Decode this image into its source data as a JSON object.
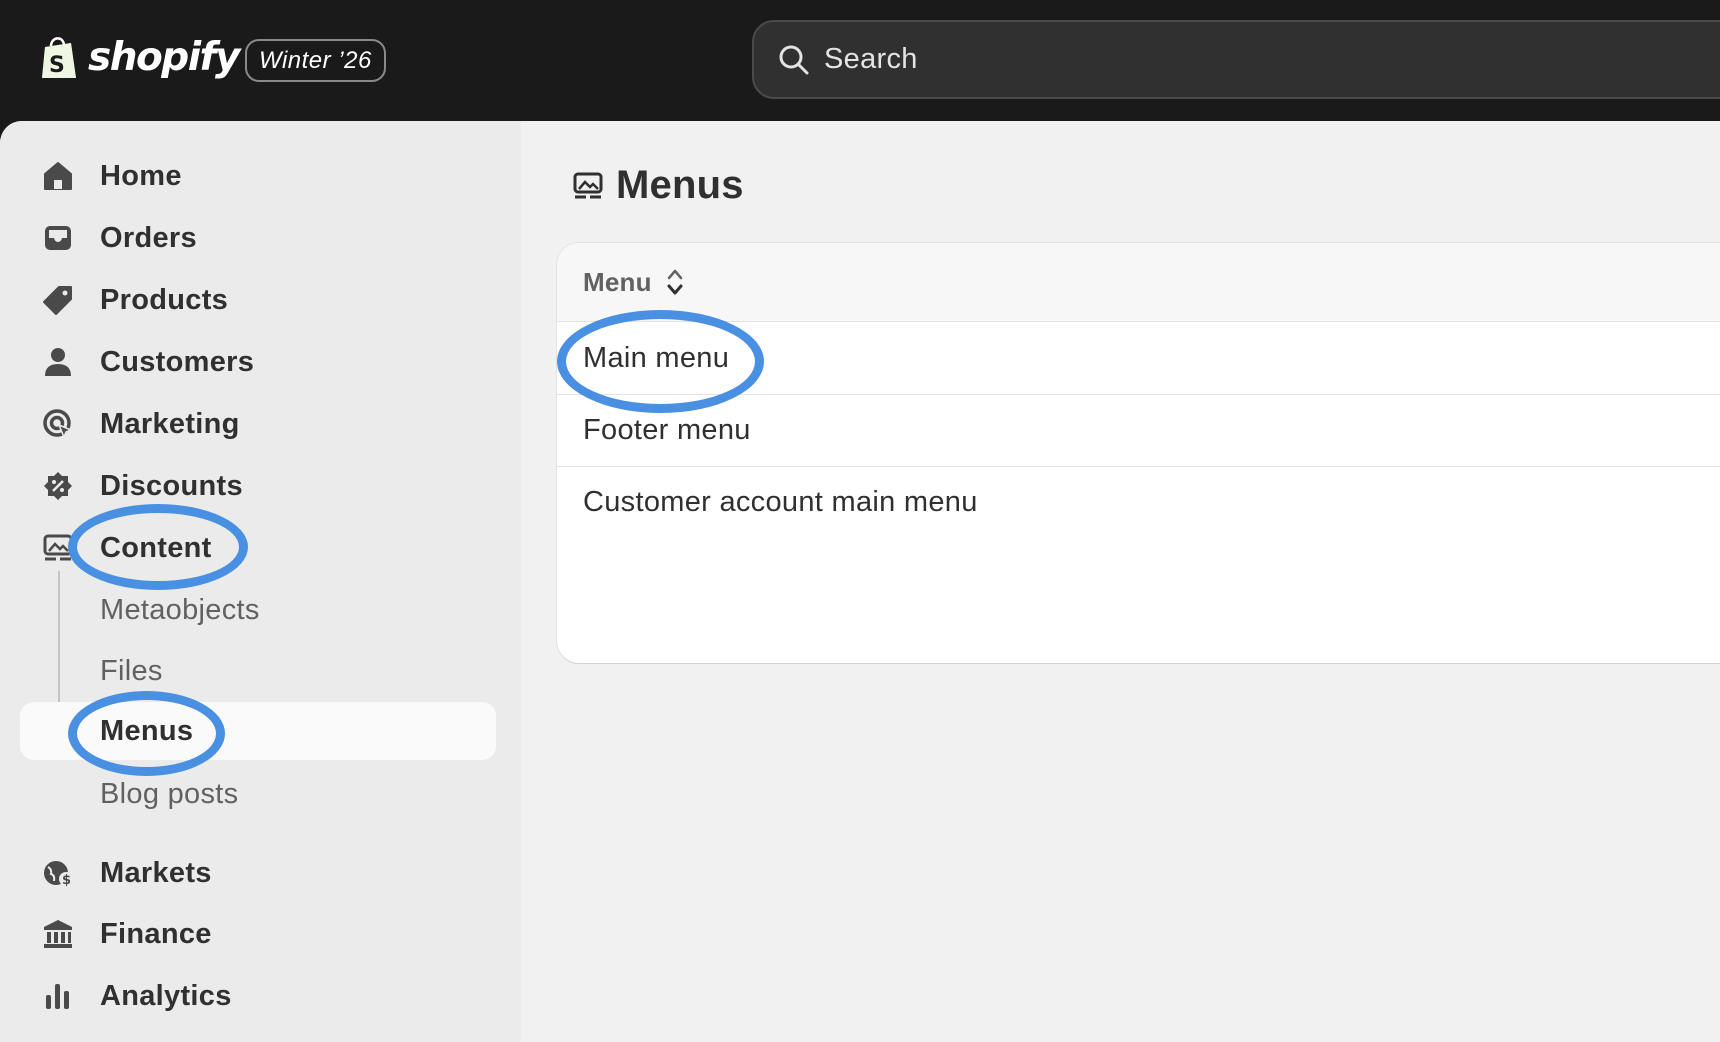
{
  "topbar": {
    "brand": "shopify",
    "edition": "Winter ’26",
    "search_placeholder": "Search"
  },
  "sidebar": {
    "items": [
      {
        "label": "Home",
        "icon": "home-icon"
      },
      {
        "label": "Orders",
        "icon": "inbox-icon"
      },
      {
        "label": "Products",
        "icon": "tag-icon"
      },
      {
        "label": "Customers",
        "icon": "person-icon"
      },
      {
        "label": "Marketing",
        "icon": "target-icon"
      },
      {
        "label": "Discounts",
        "icon": "discount-icon"
      },
      {
        "label": "Content",
        "icon": "image-icon"
      }
    ],
    "content_children": [
      {
        "label": "Metaobjects",
        "active": false
      },
      {
        "label": "Files",
        "active": false
      },
      {
        "label": "Menus",
        "active": true
      },
      {
        "label": "Blog posts",
        "active": false
      }
    ],
    "bottom_items": [
      {
        "label": "Markets",
        "icon": "globe-icon"
      },
      {
        "label": "Finance",
        "icon": "bank-icon"
      },
      {
        "label": "Analytics",
        "icon": "bar-chart-icon"
      }
    ]
  },
  "main": {
    "page_title": "Menus",
    "table": {
      "column_header": "Menu",
      "rows": [
        "Main menu",
        "Footer menu",
        "Customer account main menu"
      ]
    }
  },
  "colors": {
    "highlight": "#4a90e2",
    "topbar": "#1a1a1a"
  }
}
